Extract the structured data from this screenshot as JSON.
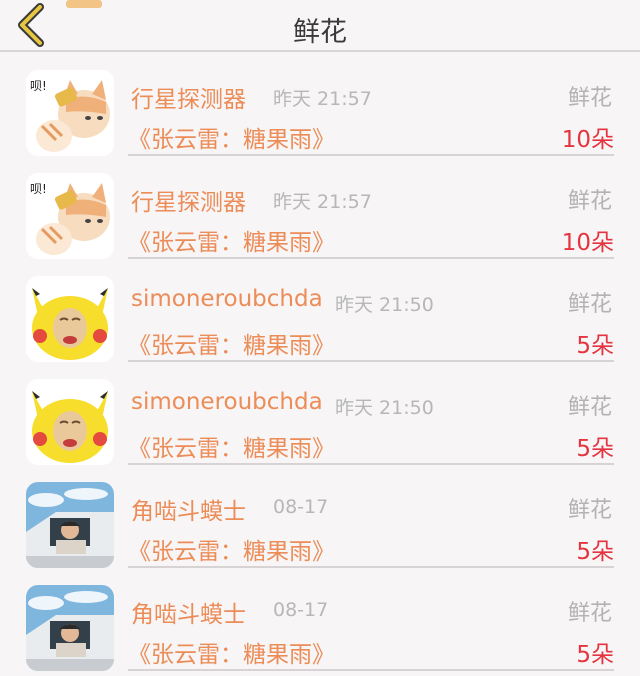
{
  "header": {
    "title": "鲜花",
    "back_icon": "chevron-left-icon",
    "accent_color": "#e8c640"
  },
  "rows": [
    {
      "avatar": "cat-sticker-avatar",
      "name": "行星探测器",
      "time": "昨天 21:57",
      "type": "鲜花",
      "song": "《张云雷：糖果雨》",
      "amount": "10朵"
    },
    {
      "avatar": "cat-sticker-avatar",
      "name": "行星探测器",
      "time": "昨天 21:57",
      "type": "鲜花",
      "song": "《张云雷：糖果雨》",
      "amount": "10朵"
    },
    {
      "avatar": "pikachu-meme-avatar",
      "name": "simoneroubchda",
      "time": "昨天 21:50",
      "type": "鲜花",
      "song": "《张云雷：糖果雨》",
      "amount": "5朵"
    },
    {
      "avatar": "pikachu-meme-avatar",
      "name": "simoneroubchda",
      "time": "昨天 21:50",
      "type": "鲜花",
      "song": "《张云雷：糖果雨》",
      "amount": "5朵"
    },
    {
      "avatar": "car-photo-avatar",
      "name": "角啮斗蟆士",
      "time": "08-17",
      "type": "鲜花",
      "song": "《张云雷：糖果雨》",
      "amount": "5朵"
    },
    {
      "avatar": "car-photo-avatar",
      "name": "角啮斗蟆士",
      "time": "08-17",
      "type": "鲜花",
      "song": "《张云雷：糖果雨》",
      "amount": "5朵"
    }
  ],
  "colors": {
    "name": "#ec8c57",
    "amount": "#e5343f",
    "secondary": "#b5b5b5"
  }
}
